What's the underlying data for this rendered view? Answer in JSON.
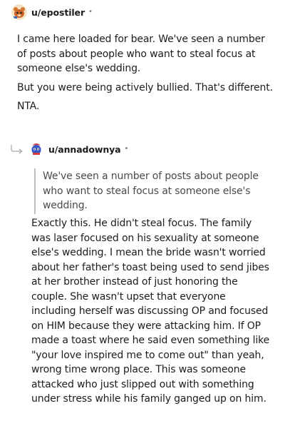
{
  "top_comment": {
    "username": "u/epostiler",
    "dot": "•",
    "avatar_icon": "snoo-avatar-icon",
    "paragraphs": [
      "I came here loaded for bear. We've seen a number of posts about people who want to steal focus at someone else's wedding.",
      "But you were being actively bullied. That's different.",
      "NTA."
    ]
  },
  "reply": {
    "username": "u/annadownya",
    "dot": "•",
    "avatar_icon": "snoo-avatar-icon",
    "reply_icon": "reply-arrow-icon",
    "quote": "We've seen a number of posts about people who want to steal focus at someone else's wedding.",
    "body": "Exactly this. He didn't steal focus. The family was laser focused on his sexuality at someone else's wedding. I mean the bride wasn't worried about her father's toast being used to send jibes at her brother instead of just honoring the couple. She wasn't upset that everyone including herself was discussing OP and focused on HIM because they were attacking him. If OP made a toast where he said even something like \"your love inspired me to come out\" than yeah, wrong time wrong place. This was someone attacked who just slipped out with something under stress while his family ganged up on him."
  },
  "colors": {
    "text": "#1c1c1c",
    "muted": "#7c7c7c",
    "quote_bar": "#bdbdbd"
  }
}
